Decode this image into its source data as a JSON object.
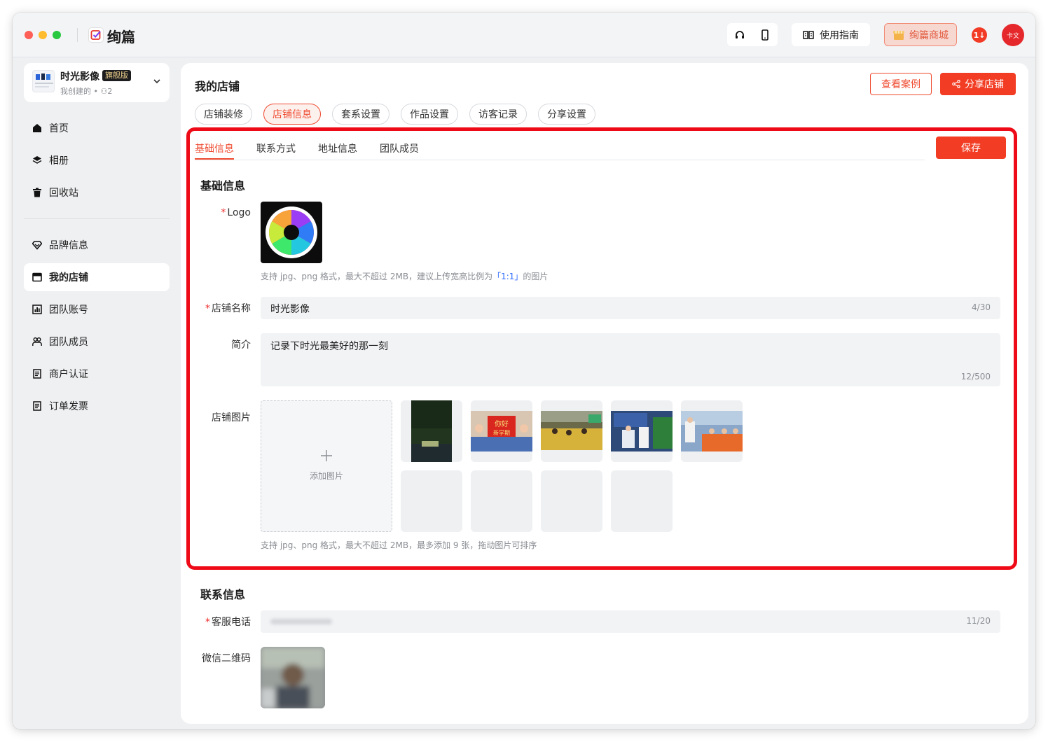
{
  "app": {
    "name": "绚篇"
  },
  "toolbar": {
    "guide_label": "使用指南",
    "shop_label": "绚篇商城",
    "badge_text": "1",
    "avatar_text": "卡文"
  },
  "store": {
    "name": "时光影像",
    "tier": "旗舰版",
    "meta": "我创建的 • ⚇2"
  },
  "sidebar": {
    "items": [
      {
        "label": "首页",
        "icon": "home-icon"
      },
      {
        "label": "相册",
        "icon": "layers-icon"
      },
      {
        "label": "回收站",
        "icon": "trash-icon"
      },
      {
        "label": "品牌信息",
        "icon": "diamond-icon"
      },
      {
        "label": "我的店铺",
        "icon": "store-icon",
        "active": true
      },
      {
        "label": "团队账号",
        "icon": "chart-icon"
      },
      {
        "label": "团队成员",
        "icon": "team-icon"
      },
      {
        "label": "商户认证",
        "icon": "document-icon"
      },
      {
        "label": "订单发票",
        "icon": "invoice-icon"
      }
    ]
  },
  "main": {
    "title": "我的店铺",
    "view_cases": "查看案例",
    "share_store": "分享店铺",
    "tabs": [
      "店铺装修",
      "店铺信息",
      "套系设置",
      "作品设置",
      "访客记录",
      "分享设置"
    ],
    "active_tab": "店铺信息",
    "subtabs": [
      "基础信息",
      "联系方式",
      "地址信息",
      "团队成员"
    ],
    "save_label": "保存"
  },
  "basic": {
    "section_title": "基础信息",
    "logo_label": "Logo",
    "logo_hint_prefix": "支持 jpg、png 格式，最大不超过 2MB，建议上传宽高比例为",
    "logo_hint_ratio": "「1:1」",
    "logo_hint_suffix": "的图片",
    "name_label": "店铺名称",
    "name_value": "时光影像",
    "name_count": "4/30",
    "intro_label": "简介",
    "intro_value": "记录下时光最美好的那一刻",
    "intro_count": "12/500",
    "images_label": "店铺图片",
    "add_image": "添加图片",
    "images_hint": "支持 jpg、png 格式，最大不超过 2MB，最多添加 9 张，拖动图片可排序"
  },
  "contact": {
    "section_title": "联系信息",
    "phone_label": "客服电话",
    "phone_count": "11/20",
    "wechat_label": "微信二维码"
  },
  "colors": {
    "accent": "#f23d24",
    "highlight": "#ee0b17",
    "link": "#2f6bff"
  }
}
